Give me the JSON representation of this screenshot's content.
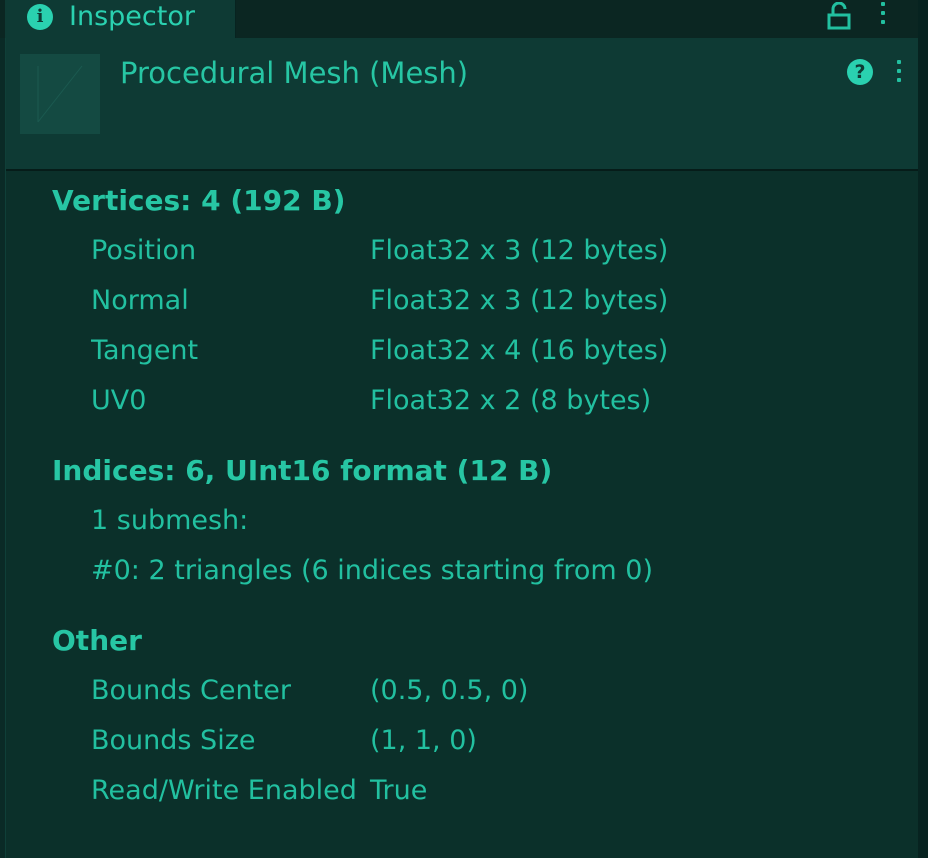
{
  "tab": {
    "title": "Inspector"
  },
  "header": {
    "title": "Procedural Mesh (Mesh)"
  },
  "vertices": {
    "title": "Vertices: 4 (192 B)",
    "rows": [
      {
        "label": "Position",
        "value": "Float32 x 3 (12 bytes)"
      },
      {
        "label": "Normal",
        "value": "Float32 x 3 (12 bytes)"
      },
      {
        "label": "Tangent",
        "value": "Float32 x 4 (16 bytes)"
      },
      {
        "label": "UV0",
        "value": "Float32 x 2 (8 bytes)"
      }
    ]
  },
  "indices": {
    "title": "Indices: 6, UInt16 format (12 B)",
    "submesh_count": "1 submesh:",
    "submesh_0": "#0: 2 triangles (6 indices starting from 0)"
  },
  "other": {
    "title": "Other",
    "rows": [
      {
        "label": "Bounds Center",
        "value": "(0.5, 0.5, 0)"
      },
      {
        "label": "Bounds Size",
        "value": "(1, 1, 0)"
      },
      {
        "label": "Read/Write Enabled",
        "value": "True"
      }
    ]
  },
  "icons": {
    "info": "info-icon",
    "lock": "lock-icon",
    "help": "help-icon",
    "menu": "kebab-menu-icon"
  },
  "colors": {
    "accent": "#22c0a0",
    "panel": "#0b302a",
    "header": "#0e3a34"
  }
}
